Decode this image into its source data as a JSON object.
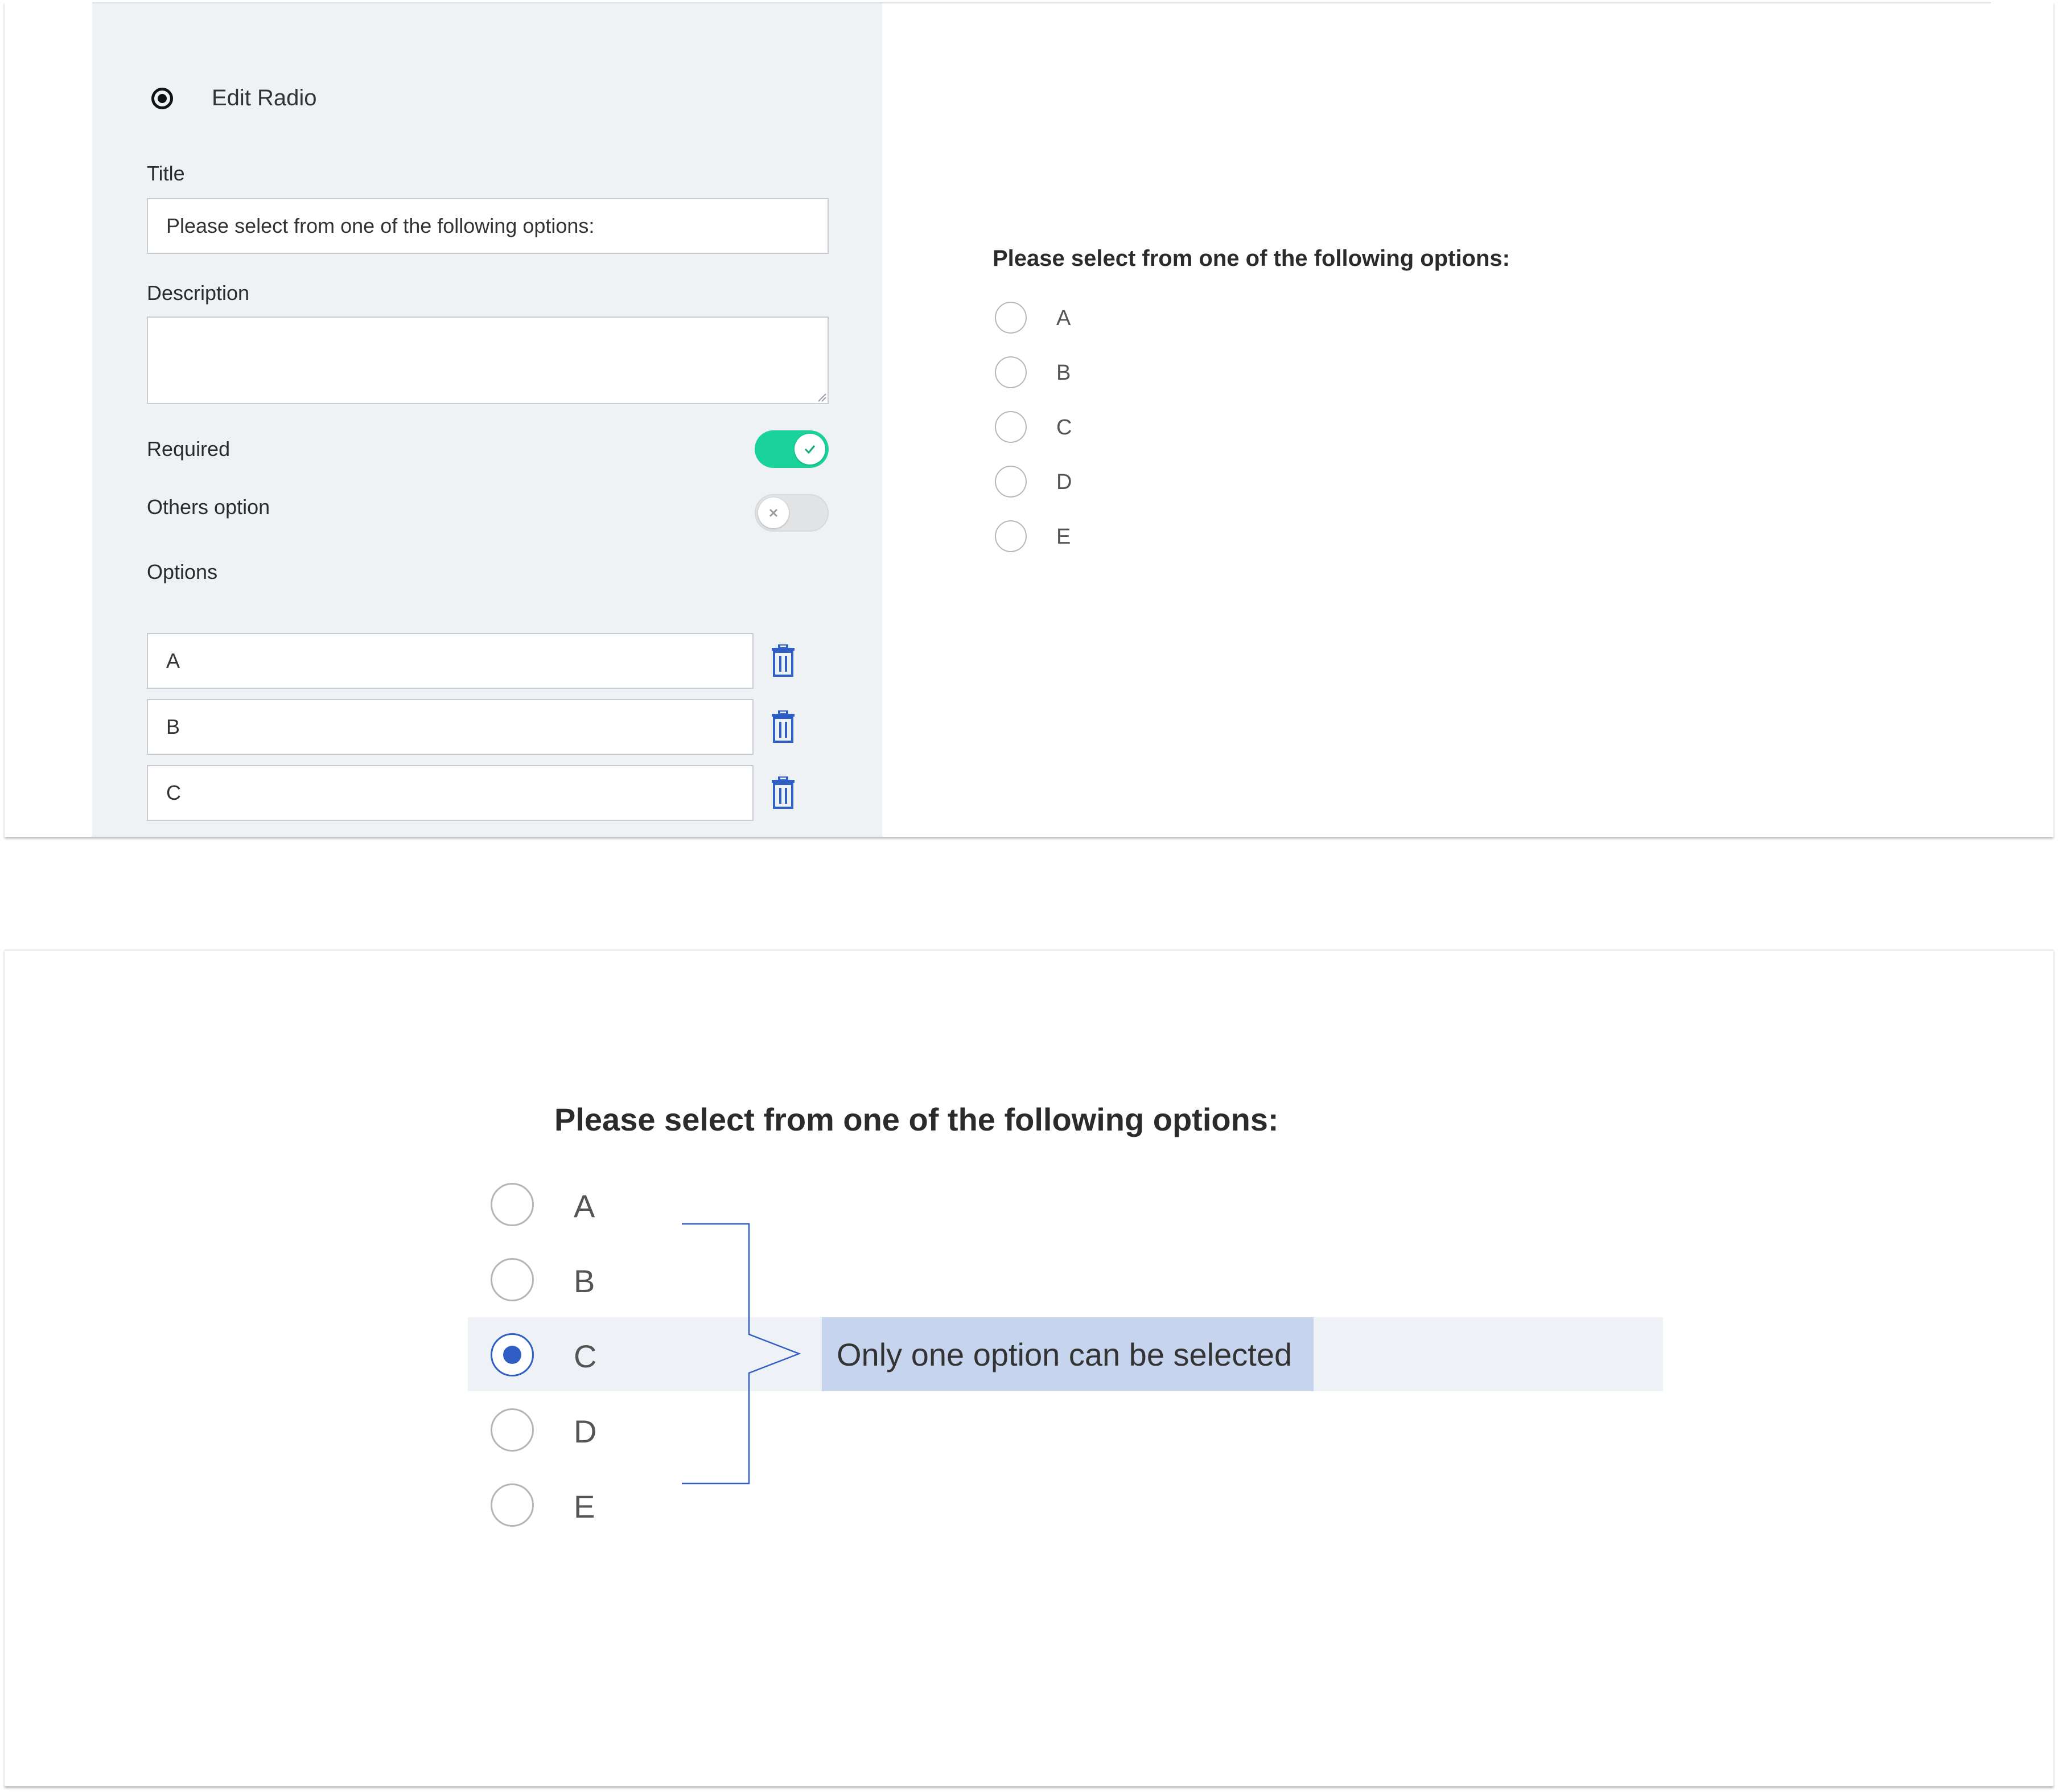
{
  "editor": {
    "header": "Edit Radio",
    "title_label": "Title",
    "title_value": "Please select from one of the following options:",
    "description_label": "Description",
    "description_value": "",
    "required_label": "Required",
    "required_on": true,
    "others_label": "Others option",
    "others_on": false,
    "options_label": "Options",
    "options": [
      "A",
      "B",
      "C"
    ]
  },
  "preview": {
    "question": "Please select from one of the following options:",
    "choices": [
      "A",
      "B",
      "C",
      "D",
      "E"
    ]
  },
  "example": {
    "question": "Please select from one of the following options:",
    "choices": [
      "A",
      "B",
      "C",
      "D",
      "E"
    ],
    "selected": "C",
    "callout": "Only one option can be selected"
  },
  "colors": {
    "toggle_on": "#19d39a",
    "accent_blue": "#2f5fc4",
    "panel_bg": "#eff2f5",
    "callout_bg": "#c7d4ee"
  }
}
